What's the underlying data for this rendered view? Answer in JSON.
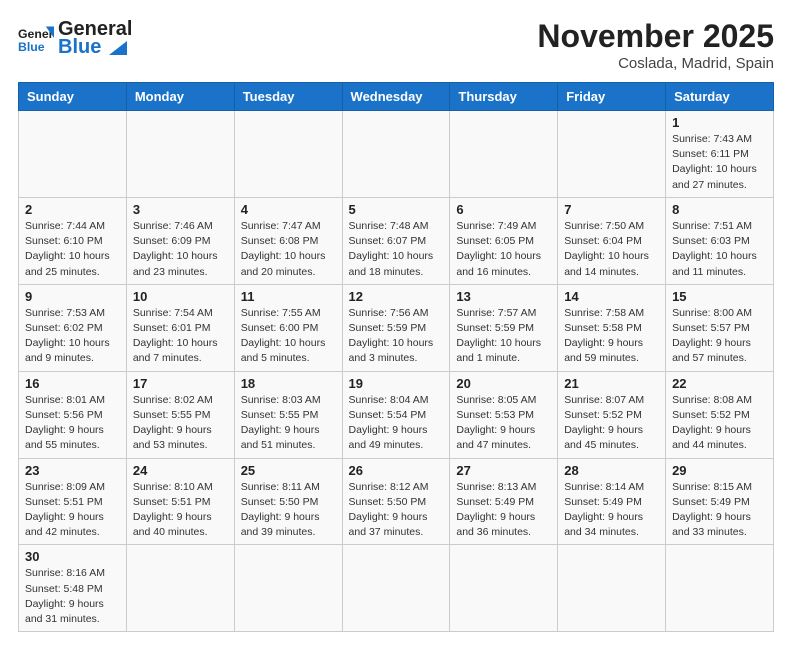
{
  "logo": {
    "text_general": "General",
    "text_blue": "Blue"
  },
  "title": "November 2025",
  "subtitle": "Coslada, Madrid, Spain",
  "weekdays": [
    "Sunday",
    "Monday",
    "Tuesday",
    "Wednesday",
    "Thursday",
    "Friday",
    "Saturday"
  ],
  "weeks": [
    [
      {
        "day": "",
        "info": ""
      },
      {
        "day": "",
        "info": ""
      },
      {
        "day": "",
        "info": ""
      },
      {
        "day": "",
        "info": ""
      },
      {
        "day": "",
        "info": ""
      },
      {
        "day": "",
        "info": ""
      },
      {
        "day": "1",
        "info": "Sunrise: 7:43 AM\nSunset: 6:11 PM\nDaylight: 10 hours\nand 27 minutes."
      }
    ],
    [
      {
        "day": "2",
        "info": "Sunrise: 7:44 AM\nSunset: 6:10 PM\nDaylight: 10 hours\nand 25 minutes."
      },
      {
        "day": "3",
        "info": "Sunrise: 7:46 AM\nSunset: 6:09 PM\nDaylight: 10 hours\nand 23 minutes."
      },
      {
        "day": "4",
        "info": "Sunrise: 7:47 AM\nSunset: 6:08 PM\nDaylight: 10 hours\nand 20 minutes."
      },
      {
        "day": "5",
        "info": "Sunrise: 7:48 AM\nSunset: 6:07 PM\nDaylight: 10 hours\nand 18 minutes."
      },
      {
        "day": "6",
        "info": "Sunrise: 7:49 AM\nSunset: 6:05 PM\nDaylight: 10 hours\nand 16 minutes."
      },
      {
        "day": "7",
        "info": "Sunrise: 7:50 AM\nSunset: 6:04 PM\nDaylight: 10 hours\nand 14 minutes."
      },
      {
        "day": "8",
        "info": "Sunrise: 7:51 AM\nSunset: 6:03 PM\nDaylight: 10 hours\nand 11 minutes."
      }
    ],
    [
      {
        "day": "9",
        "info": "Sunrise: 7:53 AM\nSunset: 6:02 PM\nDaylight: 10 hours\nand 9 minutes."
      },
      {
        "day": "10",
        "info": "Sunrise: 7:54 AM\nSunset: 6:01 PM\nDaylight: 10 hours\nand 7 minutes."
      },
      {
        "day": "11",
        "info": "Sunrise: 7:55 AM\nSunset: 6:00 PM\nDaylight: 10 hours\nand 5 minutes."
      },
      {
        "day": "12",
        "info": "Sunrise: 7:56 AM\nSunset: 5:59 PM\nDaylight: 10 hours\nand 3 minutes."
      },
      {
        "day": "13",
        "info": "Sunrise: 7:57 AM\nSunset: 5:59 PM\nDaylight: 10 hours\nand 1 minute."
      },
      {
        "day": "14",
        "info": "Sunrise: 7:58 AM\nSunset: 5:58 PM\nDaylight: 9 hours\nand 59 minutes."
      },
      {
        "day": "15",
        "info": "Sunrise: 8:00 AM\nSunset: 5:57 PM\nDaylight: 9 hours\nand 57 minutes."
      }
    ],
    [
      {
        "day": "16",
        "info": "Sunrise: 8:01 AM\nSunset: 5:56 PM\nDaylight: 9 hours\nand 55 minutes."
      },
      {
        "day": "17",
        "info": "Sunrise: 8:02 AM\nSunset: 5:55 PM\nDaylight: 9 hours\nand 53 minutes."
      },
      {
        "day": "18",
        "info": "Sunrise: 8:03 AM\nSunset: 5:55 PM\nDaylight: 9 hours\nand 51 minutes."
      },
      {
        "day": "19",
        "info": "Sunrise: 8:04 AM\nSunset: 5:54 PM\nDaylight: 9 hours\nand 49 minutes."
      },
      {
        "day": "20",
        "info": "Sunrise: 8:05 AM\nSunset: 5:53 PM\nDaylight: 9 hours\nand 47 minutes."
      },
      {
        "day": "21",
        "info": "Sunrise: 8:07 AM\nSunset: 5:52 PM\nDaylight: 9 hours\nand 45 minutes."
      },
      {
        "day": "22",
        "info": "Sunrise: 8:08 AM\nSunset: 5:52 PM\nDaylight: 9 hours\nand 44 minutes."
      }
    ],
    [
      {
        "day": "23",
        "info": "Sunrise: 8:09 AM\nSunset: 5:51 PM\nDaylight: 9 hours\nand 42 minutes."
      },
      {
        "day": "24",
        "info": "Sunrise: 8:10 AM\nSunset: 5:51 PM\nDaylight: 9 hours\nand 40 minutes."
      },
      {
        "day": "25",
        "info": "Sunrise: 8:11 AM\nSunset: 5:50 PM\nDaylight: 9 hours\nand 39 minutes."
      },
      {
        "day": "26",
        "info": "Sunrise: 8:12 AM\nSunset: 5:50 PM\nDaylight: 9 hours\nand 37 minutes."
      },
      {
        "day": "27",
        "info": "Sunrise: 8:13 AM\nSunset: 5:49 PM\nDaylight: 9 hours\nand 36 minutes."
      },
      {
        "day": "28",
        "info": "Sunrise: 8:14 AM\nSunset: 5:49 PM\nDaylight: 9 hours\nand 34 minutes."
      },
      {
        "day": "29",
        "info": "Sunrise: 8:15 AM\nSunset: 5:49 PM\nDaylight: 9 hours\nand 33 minutes."
      }
    ],
    [
      {
        "day": "30",
        "info": "Sunrise: 8:16 AM\nSunset: 5:48 PM\nDaylight: 9 hours\nand 31 minutes."
      },
      {
        "day": "",
        "info": ""
      },
      {
        "day": "",
        "info": ""
      },
      {
        "day": "",
        "info": ""
      },
      {
        "day": "",
        "info": ""
      },
      {
        "day": "",
        "info": ""
      },
      {
        "day": "",
        "info": ""
      }
    ]
  ]
}
